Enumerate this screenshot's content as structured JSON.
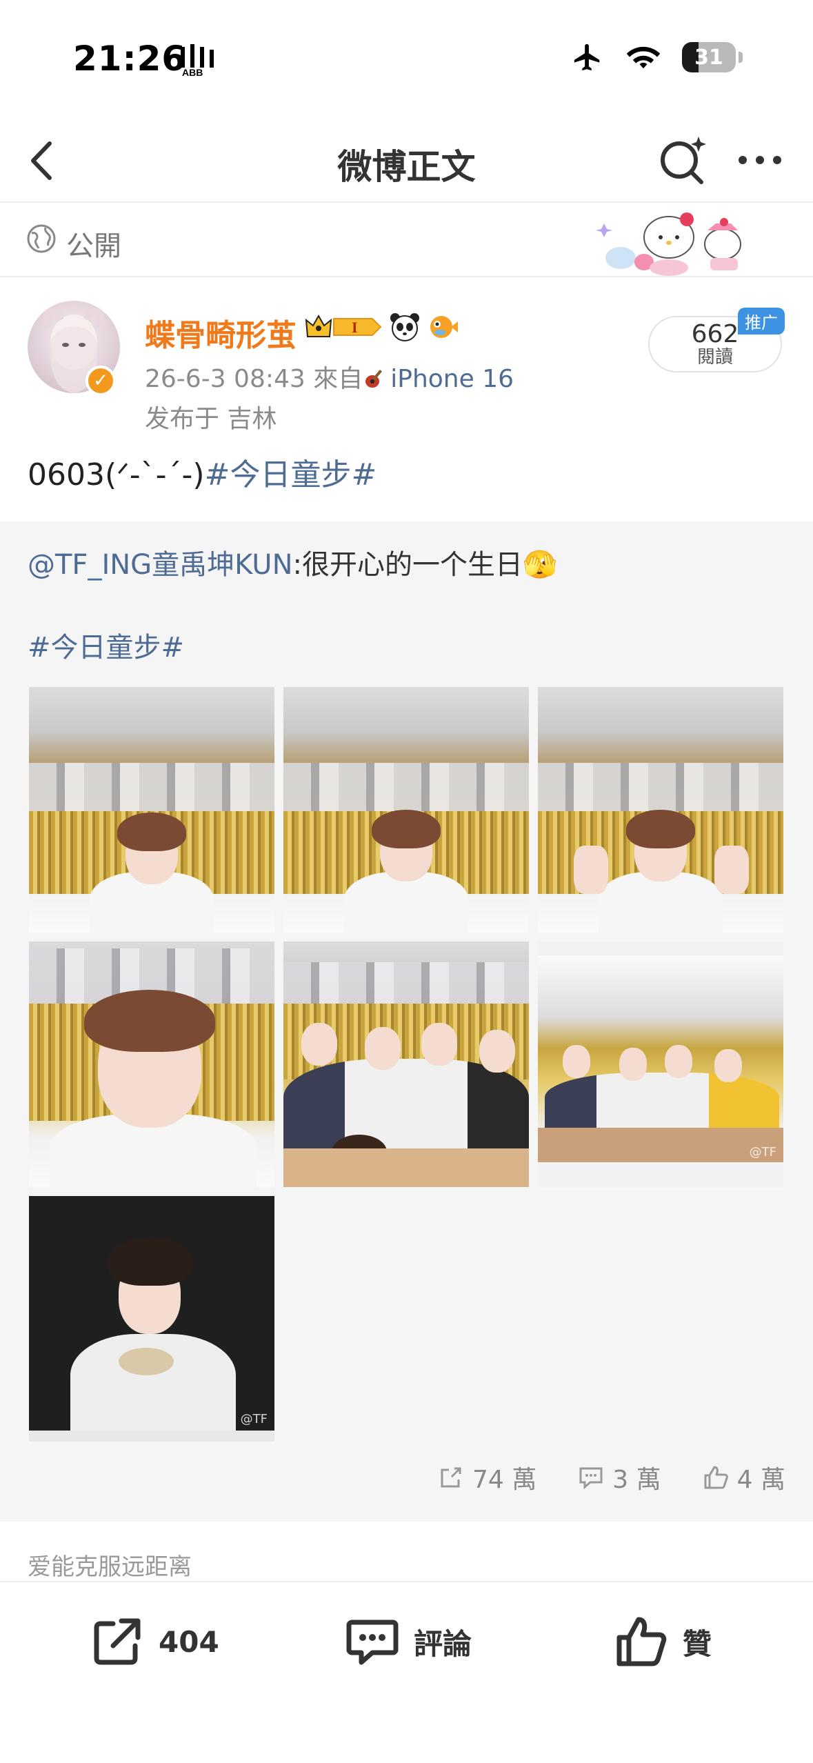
{
  "status_bar": {
    "time": "21:26",
    "battery": "31",
    "battery_level": 0.31
  },
  "nav": {
    "title": "微博正文"
  },
  "visibility": {
    "label": "公開"
  },
  "post": {
    "username": "蝶骨畸形茧",
    "vip_level": "I",
    "meta_prefix": "26-6-3 08:43  來自",
    "meta_source": "iPhone 16",
    "location": "发布于 吉林",
    "reads_count": "662",
    "reads_label": "閱讀",
    "promo_tag": "推广",
    "text_prefix": "0603(ᐟ-`-´-)",
    "topic": "#今日童步#"
  },
  "repost": {
    "mention": "@TF_ING童禹坤KUN",
    "text": ":很开心的一个生日🫣",
    "topic": "#今日童步#",
    "watermark": "@TF"
  },
  "actions": {
    "share_count": "74 萬",
    "comment_count": "3 萬",
    "like_count": "4 萬"
  },
  "comment_preview": "爱能克服远距离",
  "bottom_bar": {
    "repost_count": "404",
    "comment_label": "評論",
    "like_label": "贊"
  },
  "colors": {
    "accent_orange": "#f07a1b",
    "link_blue": "#4e6b94",
    "promo_blue": "#3e92e4"
  }
}
